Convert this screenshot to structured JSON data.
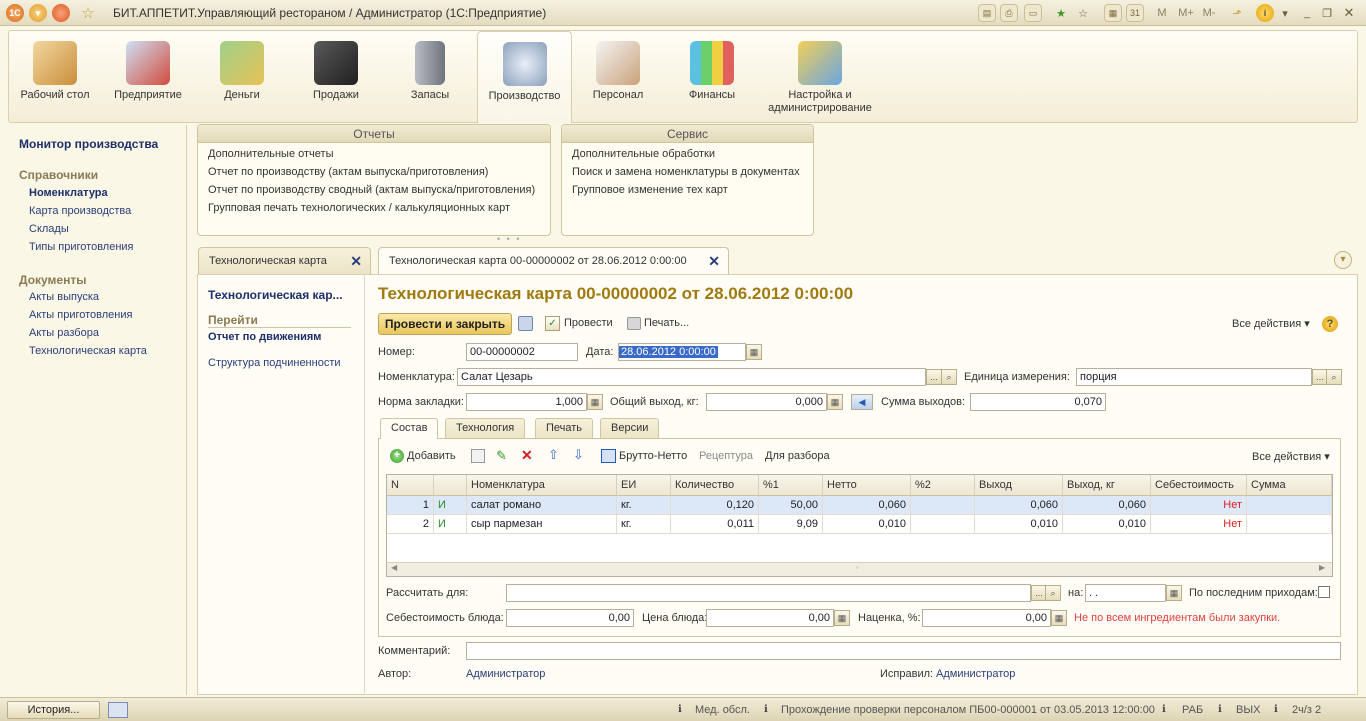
{
  "window": {
    "title": "БИТ.АППЕТИТ.Управляющий рестораном / Администратор  (1С:Предприятие)"
  },
  "titlebar_icons": [
    "1c-logo-icon",
    "dropdown-menu-icon",
    "round-orange-icon",
    "star-icon"
  ],
  "titlebar_right": {
    "m": "M",
    "mplus": "M+",
    "mminus": "M-"
  },
  "sections": [
    {
      "label": "Рабочий стол",
      "icon": "desk-icon"
    },
    {
      "label": "Предприятие",
      "icon": "enterprise-icon"
    },
    {
      "label": "Деньги",
      "icon": "money-icon"
    },
    {
      "label": "Продажи",
      "icon": "pos-terminal-icon"
    },
    {
      "label": "Запасы",
      "icon": "fridge-icon"
    },
    {
      "label": "Производство",
      "icon": "cooking-pot-icon",
      "active": true
    },
    {
      "label": "Персонал",
      "icon": "chefs-icon"
    },
    {
      "label": "Финансы",
      "icon": "bar-chart-icon"
    },
    {
      "label": "Настройка и администрирование",
      "icon": "database-computer-icon"
    }
  ],
  "leftnav": {
    "top": "Монитор производства",
    "ref_header": "Справочники",
    "ref_items": [
      "Номенклатура",
      "Карта производства",
      "Склады",
      "Типы приготовления"
    ],
    "doc_header": "Документы",
    "doc_items": [
      "Акты выпуска",
      "Акты приготовления",
      "Акты разбора",
      "Технологическая карта"
    ]
  },
  "reports": {
    "title": "Отчеты",
    "items": [
      "Дополнительные отчеты",
      "Отчет по производству (актам выпуска/приготовления)",
      "Отчет по производству сводный (актам выпуска/приготовления)",
      "Групповая печать технологических / калькуляционных карт"
    ]
  },
  "service": {
    "title": "Сервис",
    "items": [
      "Дополнительные обработки",
      "Поиск и замена номенклатуры в документах",
      "Групповое изменение тех карт"
    ]
  },
  "tabs": [
    "Технологическая карта",
    "Технологическая карта 00-00000002 от 28.06.2012 0:00:00"
  ],
  "docnav": {
    "current": "Технологическая кар...",
    "goto": "Перейти",
    "report": "Отчет по движениям",
    "structure": "Структура подчиненности"
  },
  "doc": {
    "title": "Технологическая карта 00-00000002 от 28.06.2012 0:00:00",
    "post_close": "Провести и закрыть",
    "post": "Провести",
    "print": "Печать...",
    "all_actions": "Все действия",
    "number_label": "Номер:",
    "number": "00-00000002",
    "date_label": "Дата:",
    "date": "28.06.2012  0:00:00",
    "nom_label": "Номенклатура:",
    "nom": "Салат Цезарь",
    "unit_label": "Единица измерения:",
    "unit": "порция",
    "norm_label": "Норма закладки:",
    "norm": "1,000",
    "total_label": "Общий выход, кг:",
    "total": "0,000",
    "sum_label": "Сумма выходов:",
    "sum": "0,070",
    "inner_tabs": [
      "Состав",
      "Технология",
      "Печать",
      "Версии"
    ],
    "add": "Добавить",
    "brutto": "Брутто-Нетто",
    "recipe": "Рецептура",
    "disassembly": "Для разбора",
    "grid_headers": [
      "N",
      "",
      "Номенклатура",
      "ЕИ",
      "Количество",
      "%1",
      "Нетто",
      "%2",
      "Выход",
      "Выход, кг",
      "Себестоимость",
      "Сумма"
    ],
    "grid_rows": [
      [
        "1",
        "И",
        "салат романо",
        "кг.",
        "0,120",
        "50,00",
        "0,060",
        "",
        "0,060",
        "0,060",
        "Нет",
        ""
      ],
      [
        "2",
        "И",
        "сыр пармезан",
        "кг.",
        "0,011",
        "9,09",
        "0,010",
        "",
        "0,010",
        "0,010",
        "Нет",
        ""
      ]
    ],
    "calc_label": "Рассчитать для:",
    "na_label": "на:",
    "na_value": " .  .",
    "last_label": "По последним приходам:",
    "cost_label": "Себестоимость блюда:",
    "cost": "0,00",
    "price_label": "Цена блюда:",
    "price": "0,00",
    "markup_label": "Наценка, %:",
    "markup": "0,00",
    "warn": "Не по всем ингредиентам были закупки.",
    "comment_label": "Комментарий:",
    "author_label": "Автор:",
    "author": "Администратор",
    "fixed_label": "Исправил:",
    "fixed": "Администратор"
  },
  "status": {
    "history": "История...",
    "med": "Мед. обсл.",
    "check": "Прохождение проверки персоналом ПБ00-000001 от 03.05.2013 12:00:00",
    "rab": "РАБ",
    "vyh": "ВЫХ",
    "page": "2ч/з 2"
  }
}
